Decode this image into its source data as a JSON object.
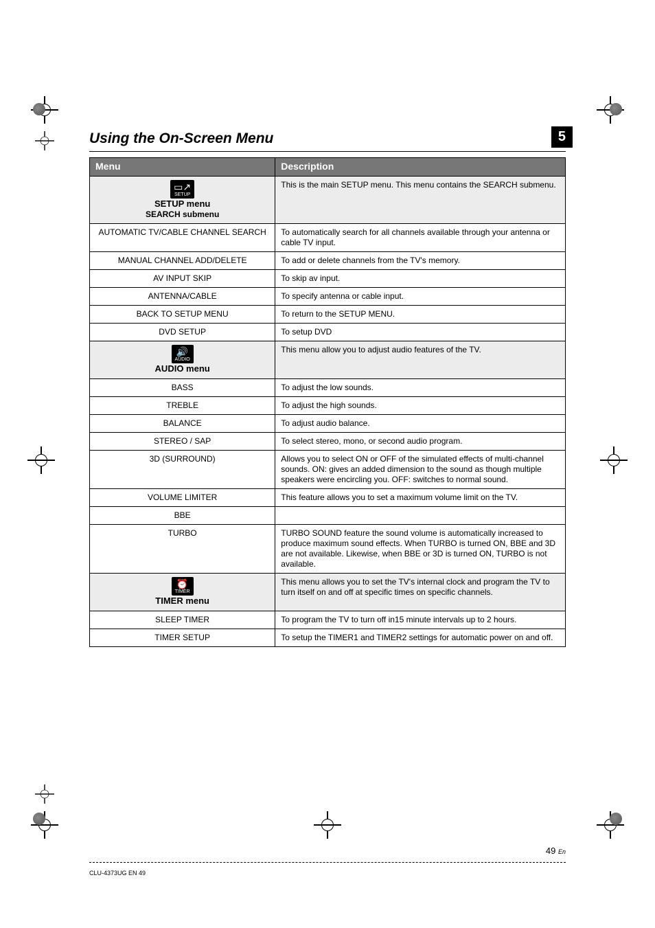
{
  "chapter": {
    "title": "Using the On-Screen Menu",
    "corner_number": "5"
  },
  "table": {
    "headers": {
      "col1": "Menu",
      "col2": "Description"
    },
    "sections": [
      {
        "icon_label": "SETUP",
        "menu_name": "SETUP menu",
        "submenu": "SEARCH submenu",
        "menu_desc": "This is the main SETUP menu. This menu contains the SEARCH submenu.",
        "rows": [
          {
            "item": "AUTOMATIC TV/CABLE CHANNEL SEARCH",
            "desc": "To automatically search for all channels available through your antenna or cable TV input."
          },
          {
            "item": "MANUAL CHANNEL ADD/DELETE",
            "desc": "To add or delete channels from the TV's memory."
          },
          {
            "item": "AV INPUT SKIP",
            "desc": "To skip av input."
          },
          {
            "item": "ANTENNA/CABLE",
            "desc": "To specify antenna or cable input."
          },
          {
            "item": "BACK TO SETUP MENU",
            "desc": "To return to the SETUP MENU."
          },
          {
            "item": "DVD SETUP",
            "desc": "To setup DVD"
          }
        ]
      },
      {
        "icon_label": "AUDIO",
        "menu_name": "AUDIO menu",
        "submenu": "",
        "menu_desc": "This menu allow you to adjust audio features of the TV.",
        "rows": [
          {
            "item": "BASS",
            "desc": "To adjust the low sounds."
          },
          {
            "item": "TREBLE",
            "desc": "To adjust the high sounds."
          },
          {
            "item": "BALANCE",
            "desc": "To adjust audio balance."
          },
          {
            "item": "STEREO / SAP",
            "desc": "To select stereo, mono, or second audio program."
          },
          {
            "item": "3D (SURROUND)",
            "desc": "Allows you to select ON or OFF of the simulated effects of multi-channel sounds. ON: gives an added dimension to the sound as though multiple speakers were encircling you. OFF: switches to normal sound."
          },
          {
            "item": "VOLUME LIMITER",
            "desc": "This feature allows you to set a maximum volume limit on the TV."
          },
          {
            "item": "BBE",
            "desc": ""
          },
          {
            "item": "TURBO",
            "desc": "TURBO SOUND feature the sound volume is automatically increased to produce maximum sound effects. When TURBO is turned ON, BBE and 3D are not available. Likewise, when BBE or 3D is turned ON, TURBO is not available."
          }
        ]
      },
      {
        "icon_label": "TIMER",
        "menu_name": "TIMER menu",
        "submenu": "",
        "menu_desc": "This menu allows you to set the TV's internal clock and program the TV to turn itself on and off at specific times on specific channels.",
        "rows": [
          {
            "item": "SLEEP TIMER",
            "desc": "To program the TV to turn off in15 minute intervals up to 2 hours."
          },
          {
            "item": "TIMER SETUP",
            "desc": "To setup the TIMER1 and TIMER2 settings for automatic power on and off."
          }
        ]
      }
    ]
  },
  "page_number": {
    "main": "49",
    "suffix": "En"
  },
  "footer": "CLU-4373UG EN  49"
}
